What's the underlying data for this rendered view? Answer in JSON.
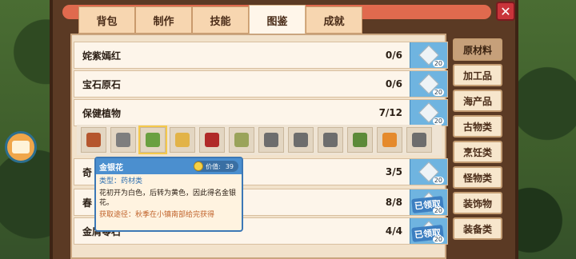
{
  "tabs": [
    {
      "label": "背包"
    },
    {
      "label": "制作"
    },
    {
      "label": "技能"
    },
    {
      "label": "图鉴"
    },
    {
      "label": "成就"
    }
  ],
  "active_tab": "图鉴",
  "close_label": "✕",
  "rows": [
    {
      "name": "姹紫嫣红",
      "count": "0/6",
      "reward": "20",
      "claimed": ""
    },
    {
      "name": "宝石原石",
      "count": "0/6",
      "reward": "20",
      "claimed": ""
    },
    {
      "name": "保健植物",
      "count": "7/12",
      "reward": "20",
      "claimed": ""
    },
    {
      "name": "奇",
      "count": "3/5",
      "reward": "20",
      "claimed": ""
    },
    {
      "name": "春",
      "count": "8/8",
      "reward": "20",
      "claimed": "已领取"
    },
    {
      "name": "金屑零石",
      "count": "4/4",
      "reward": "20",
      "claimed": "已领取"
    }
  ],
  "item_icons": [
    "root",
    "mushroom-gray",
    "herb-green",
    "root-yellow",
    "mushroom-red",
    "herb-flower",
    "leaf-gray",
    "leaf-gray-2",
    "leaf-gray-3",
    "herb-red-berry",
    "carrot-orange",
    "leaf-gray-4"
  ],
  "tooltip": {
    "title": "金银花",
    "price_label": "价值:",
    "price_value": "39",
    "type": "类型：药材类",
    "desc": "花初开为白色，后转为黄色，因此得名金银花。",
    "source": "获取途径：秋季在小镇南部给完获得"
  },
  "categories": [
    {
      "label": "原材料"
    },
    {
      "label": "加工品"
    },
    {
      "label": "海产品"
    },
    {
      "label": "古物类"
    },
    {
      "label": "烹饪类"
    },
    {
      "label": "怪物类"
    },
    {
      "label": "装饰物"
    },
    {
      "label": "装备类"
    }
  ],
  "active_category": "原材料",
  "colors": {
    "accent_blue": "#4b8fcf",
    "panel_brown": "#5b3a24",
    "tab_cream": "#f7d6b0"
  }
}
